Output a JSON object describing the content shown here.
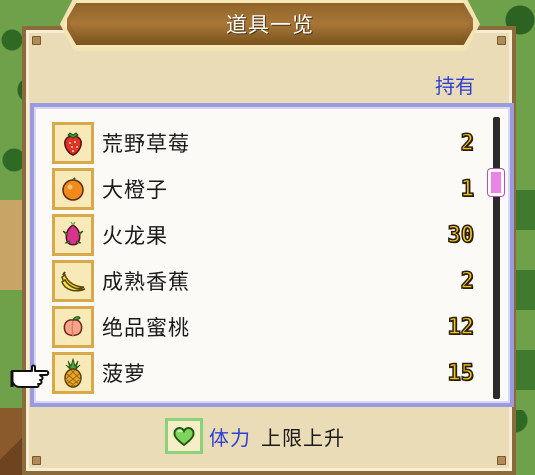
{
  "window": {
    "title": "道具一览"
  },
  "list": {
    "header": "持有",
    "items": [
      {
        "name": "荒野草莓",
        "count": "2",
        "icon": "strawberry-icon"
      },
      {
        "name": "大橙子",
        "count": "1",
        "icon": "orange-icon"
      },
      {
        "name": "火龙果",
        "count": "30",
        "icon": "dragon-fruit-icon"
      },
      {
        "name": "成熟香蕉",
        "count": "2",
        "icon": "banana-icon"
      },
      {
        "name": "绝品蜜桃",
        "count": "12",
        "icon": "peach-icon"
      },
      {
        "name": "菠萝",
        "count": "15",
        "icon": "pineapple-icon"
      }
    ],
    "selected_index": 5
  },
  "footer": {
    "stat_name": "体力",
    "stat_effect": "上限上升",
    "icon": "heart-icon"
  },
  "colors": {
    "panel": "#eadcb7",
    "title_bar": "#a37234",
    "accent_blue": "#2d3fd6",
    "count_yellow": "#f3c61f",
    "scroll_thumb": "#e983e6",
    "list_border": "#9a9adf"
  }
}
